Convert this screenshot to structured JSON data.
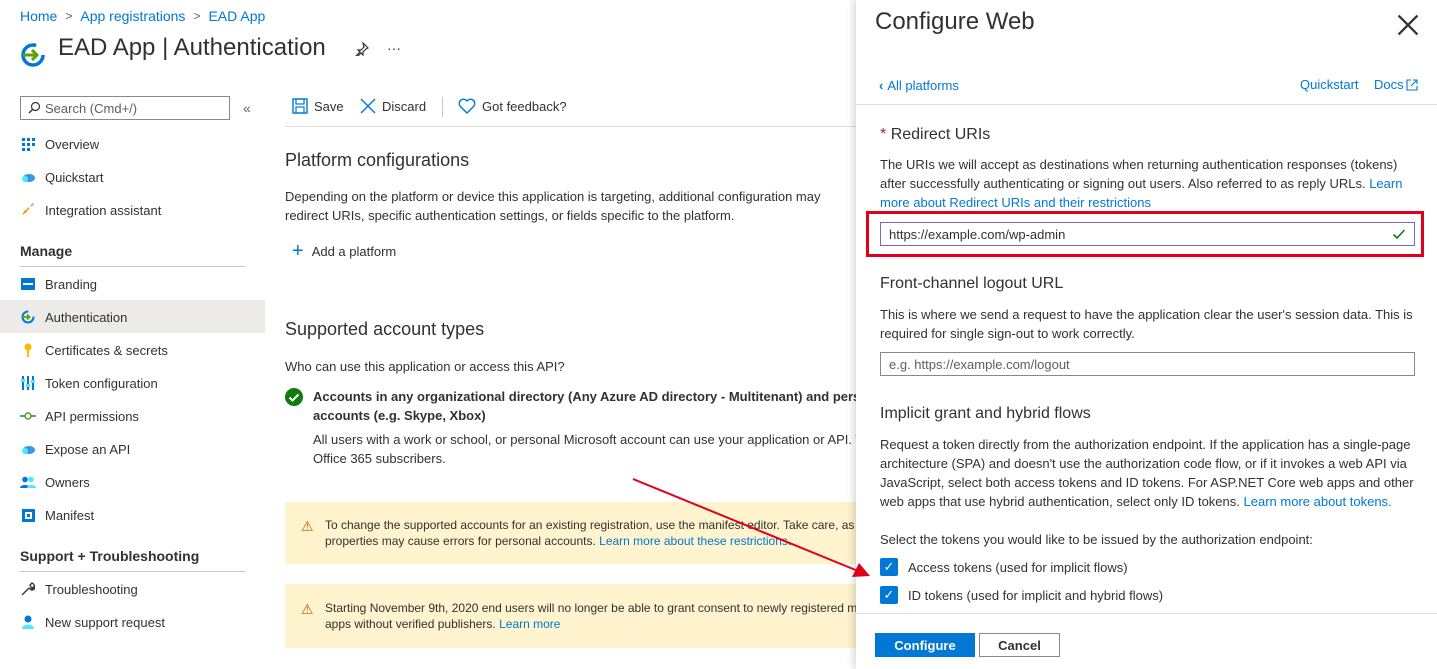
{
  "breadcrumb": [
    "Home",
    "App registrations",
    "EAD App"
  ],
  "page": {
    "app_name": "EAD App",
    "section": "Authentication",
    "more": "···"
  },
  "sidebar": {
    "search_placeholder": "Search (Cmd+/)",
    "collapse": "«",
    "top_items": [
      "Overview",
      "Quickstart",
      "Integration assistant"
    ],
    "manage_header": "Manage",
    "manage_items": [
      "Branding",
      "Authentication",
      "Certificates & secrets",
      "Token configuration",
      "API permissions",
      "Expose an API",
      "Owners",
      "Manifest"
    ],
    "support_header": "Support + Troubleshooting",
    "support_items": [
      "Troubleshooting",
      "New support request"
    ]
  },
  "toolbar": {
    "save": "Save",
    "discard": "Discard",
    "feedback": "Got feedback?"
  },
  "main": {
    "platform_title": "Platform configurations",
    "platform_desc_1": "Depending on the platform or device this application is targeting, additional configuration may",
    "platform_desc_2": "redirect URIs, specific authentication settings, or fields specific to the platform.",
    "add_platform": "Add a platform",
    "account_title": "Supported account types",
    "account_question": "Who can use this application or access this API?",
    "account_option_1": "Accounts in any organizational directory (Any Azure AD directory - Multitenant) and pers",
    "account_option_2": "accounts (e.g. Skype, Xbox)",
    "account_desc_1": "All users with a work or school, or personal Microsoft account can use your application or API. T",
    "account_desc_2": "Office 365 subscribers.",
    "warn1_1": "To change the supported accounts for an existing registration, use the manifest editor. Take care, as",
    "warn1_2": "properties may cause errors for personal accounts.",
    "warn1_link": "Learn more about these restrictions.",
    "warn2_1": "Starting November 9th, 2020 end users will no longer be able to grant consent to newly registered m",
    "warn2_2": "apps without verified publishers.",
    "warn2_link": "Learn more"
  },
  "panel": {
    "title": "Configure Web",
    "back": "All platforms",
    "quickstart": "Quickstart",
    "docs": "Docs",
    "redirect_required": "*",
    "redirect_title": "Redirect URIs",
    "redirect_desc_1": "The URIs we will accept as destinations when returning authentication responses (tokens)",
    "redirect_desc_2": "after successfully authenticating or signing out users. Also referred to as reply URLs.",
    "redirect_link_1": "Learn",
    "redirect_link_2": "more about Redirect URIs and their restrictions",
    "redirect_value": "https://example.com/wp-admin",
    "logout_title": "Front-channel logout URL",
    "logout_desc_1": "This is where we send a request to have the application clear the user's session data. This is",
    "logout_desc_2": "required for single sign-out to work correctly.",
    "logout_placeholder": "e.g. https://example.com/logout",
    "implicit_title": "Implicit grant and hybrid flows",
    "implicit_desc_1": "Request a token directly from the authorization endpoint. If the application has a single-page",
    "implicit_desc_2": "architecture (SPA) and doesn't use the authorization code flow, or if it invokes a web API via",
    "implicit_desc_3": "JavaScript, select both access tokens and ID tokens. For ASP.NET Core web apps and other",
    "implicit_desc_4": "web apps that use hybrid authentication, select only ID tokens.",
    "implicit_link": "Learn more about tokens.",
    "tokens_prompt": "Select the tokens you would like to be issued by the authorization endpoint:",
    "access_tokens": "Access tokens (used for implicit flows)",
    "id_tokens": "ID tokens (used for implicit and hybrid flows)",
    "configure": "Configure",
    "cancel": "Cancel"
  },
  "colors": {
    "accent": "#0078d4",
    "highlight": "#e0001b",
    "warning_bg": "#fff4ce"
  }
}
